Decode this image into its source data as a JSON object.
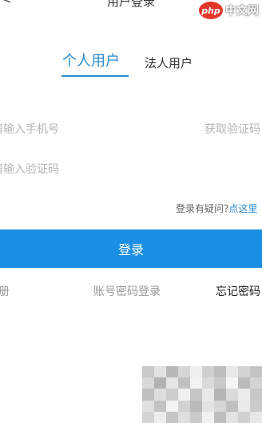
{
  "header": {
    "back_glyph": "<",
    "title": "用户登录"
  },
  "watermark": {
    "logo": "php",
    "text": "中文网"
  },
  "tabs": {
    "personal": "个人用户",
    "corporate": "法人用户"
  },
  "form": {
    "phone_placeholder": "请输入手机号",
    "get_code_label": "获取验证码",
    "code_placeholder": "请输入验证码"
  },
  "help": {
    "question": "登录有疑问?",
    "link": "点这里"
  },
  "login_button": "登录",
  "links": {
    "register": "注册",
    "password_login": "账号密码登录",
    "forgot_password": "忘记密码"
  },
  "colors": {
    "accent": "#2a8ad0",
    "button": "#1a8fe3",
    "placeholder": "#b5b5b5"
  }
}
